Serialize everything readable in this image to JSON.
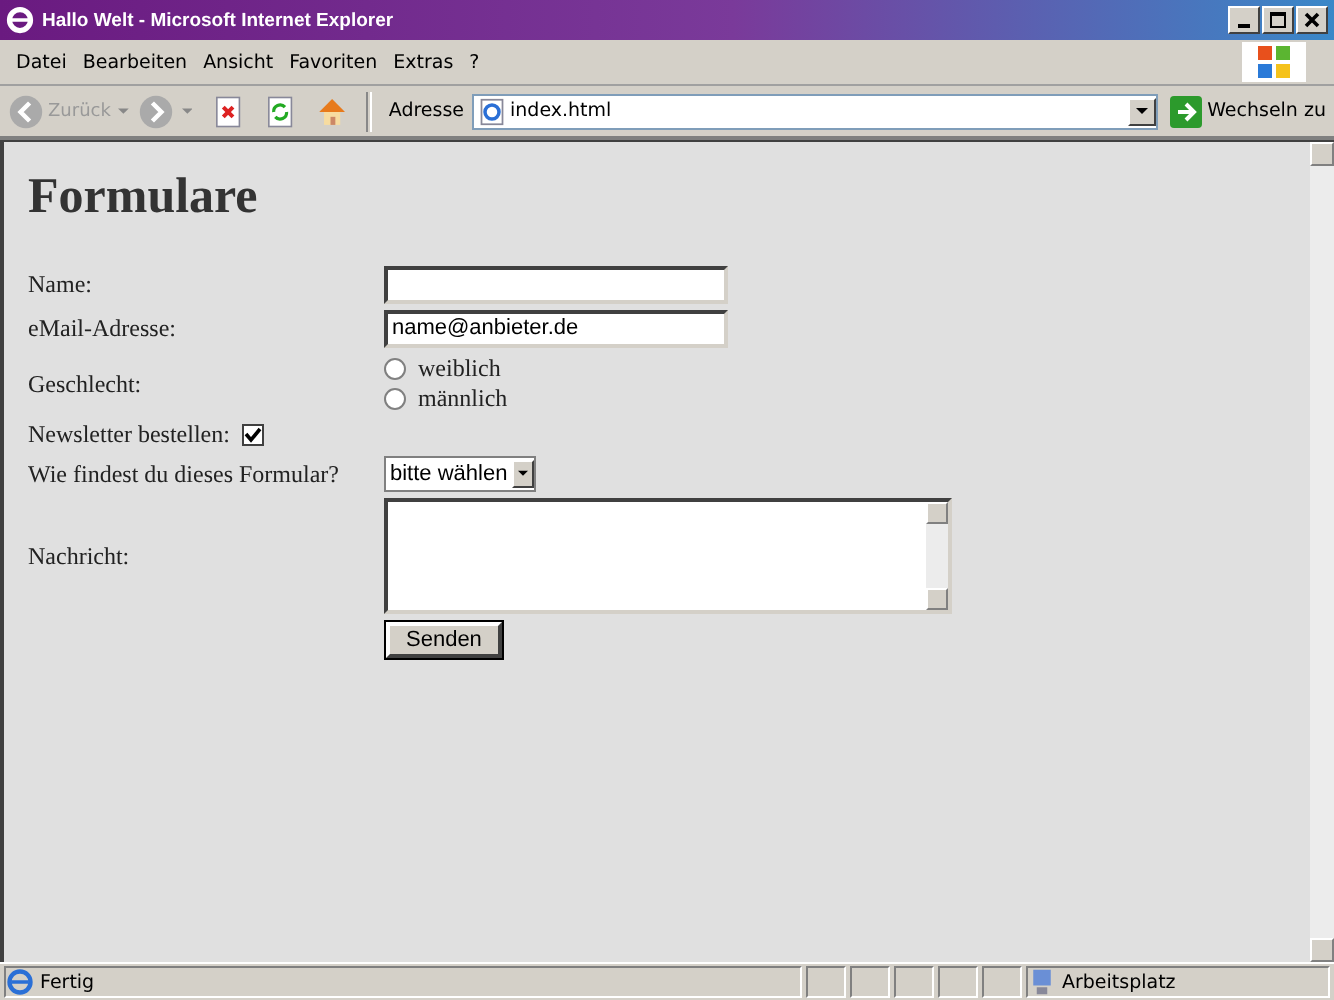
{
  "window": {
    "title": "Hallo Welt - Microsoft Internet Explorer"
  },
  "menu": [
    "Datei",
    "Bearbeiten",
    "Ansicht",
    "Favoriten",
    "Extras",
    "?"
  ],
  "toolbar": {
    "back_label": "Zurück",
    "address_label": "Adresse",
    "address": "index.html",
    "go_label": "Wechseln zu"
  },
  "page": {
    "heading": "Formulare",
    "rows": [
      {
        "kind": "text",
        "label": "Name:",
        "value": ""
      },
      {
        "kind": "text",
        "label": "eMail-Adresse:",
        "value": "name@anbieter.de"
      },
      {
        "kind": "radio",
        "label": "Geschlecht:",
        "options": [
          {
            "label": "weiblich",
            "selected": false
          },
          {
            "label": "männlich",
            "selected": false
          }
        ]
      },
      {
        "kind": "checkbox",
        "label": "Newsletter bestellen:",
        "checked": true
      },
      {
        "kind": "select",
        "label": "Wie findest du dieses Formular?",
        "value": "bitte wählen"
      },
      {
        "kind": "textarea",
        "label": "Nachricht:",
        "value": ""
      },
      {
        "kind": "submit",
        "label": "",
        "button": "Senden"
      }
    ]
  },
  "status_bar": {
    "text": "Fertig",
    "zone": "Arbeitsplatz"
  }
}
